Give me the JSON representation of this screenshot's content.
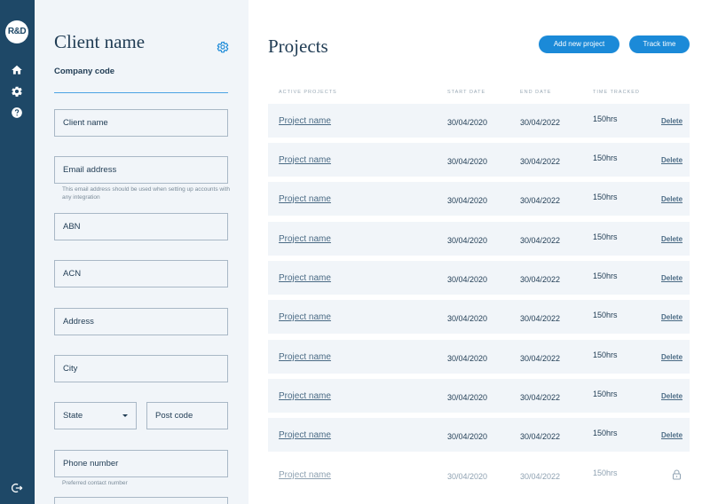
{
  "nav": {
    "logo": "R&D",
    "icons": [
      "home-icon",
      "gear-icon",
      "help-icon",
      "logout-icon"
    ]
  },
  "client": {
    "title": "Client name",
    "company_code_label": "Company code",
    "fields": {
      "client_name": "Client name",
      "email": "Email address",
      "email_help": "This email address should be used when setting up accounts with any integration",
      "abn": "ABN",
      "acn": "ACN",
      "address": "Address",
      "city": "City",
      "state": "State",
      "post_code": "Post code",
      "phone": "Phone number",
      "phone_help": "Preferred contact number"
    }
  },
  "projects": {
    "title": "Projects",
    "add_button": "Add new project",
    "track_button": "Track time",
    "columns": {
      "name": "ACTIVE PROJECTS",
      "start": "START DATE",
      "end": "END DATE",
      "time": "TIME TRACKED"
    },
    "rows": [
      {
        "name": "Project name",
        "start": "30/04/2020",
        "end": "30/04/2022",
        "hours": "150hrs",
        "action": "Delete"
      },
      {
        "name": "Project name",
        "start": "30/04/2020",
        "end": "30/04/2022",
        "hours": "150hrs",
        "action": "Delete"
      },
      {
        "name": "Project name",
        "start": "30/04/2020",
        "end": "30/04/2022",
        "hours": "150hrs",
        "action": "Delete"
      },
      {
        "name": "Project name",
        "start": "30/04/2020",
        "end": "30/04/2022",
        "hours": "150hrs",
        "action": "Delete"
      },
      {
        "name": "Project name",
        "start": "30/04/2020",
        "end": "30/04/2022",
        "hours": "150hrs",
        "action": "Delete"
      },
      {
        "name": "Project name",
        "start": "30/04/2020",
        "end": "30/04/2022",
        "hours": "150hrs",
        "action": "Delete"
      },
      {
        "name": "Project name",
        "start": "30/04/2020",
        "end": "30/04/2022",
        "hours": "150hrs",
        "action": "Delete"
      },
      {
        "name": "Project name",
        "start": "30/04/2020",
        "end": "30/04/2022",
        "hours": "150hrs",
        "action": "Delete"
      },
      {
        "name": "Project name",
        "start": "30/04/2020",
        "end": "30/04/2022",
        "hours": "150hrs",
        "action": "Delete"
      },
      {
        "name": "Project name",
        "start": "30/04/2020",
        "end": "30/04/2022",
        "hours": "150hrs",
        "locked": true
      }
    ]
  },
  "colors": {
    "rail": "#1e4867",
    "accent": "#1b8ad8",
    "panel": "#f1f5f9",
    "text": "#1f3b53"
  }
}
